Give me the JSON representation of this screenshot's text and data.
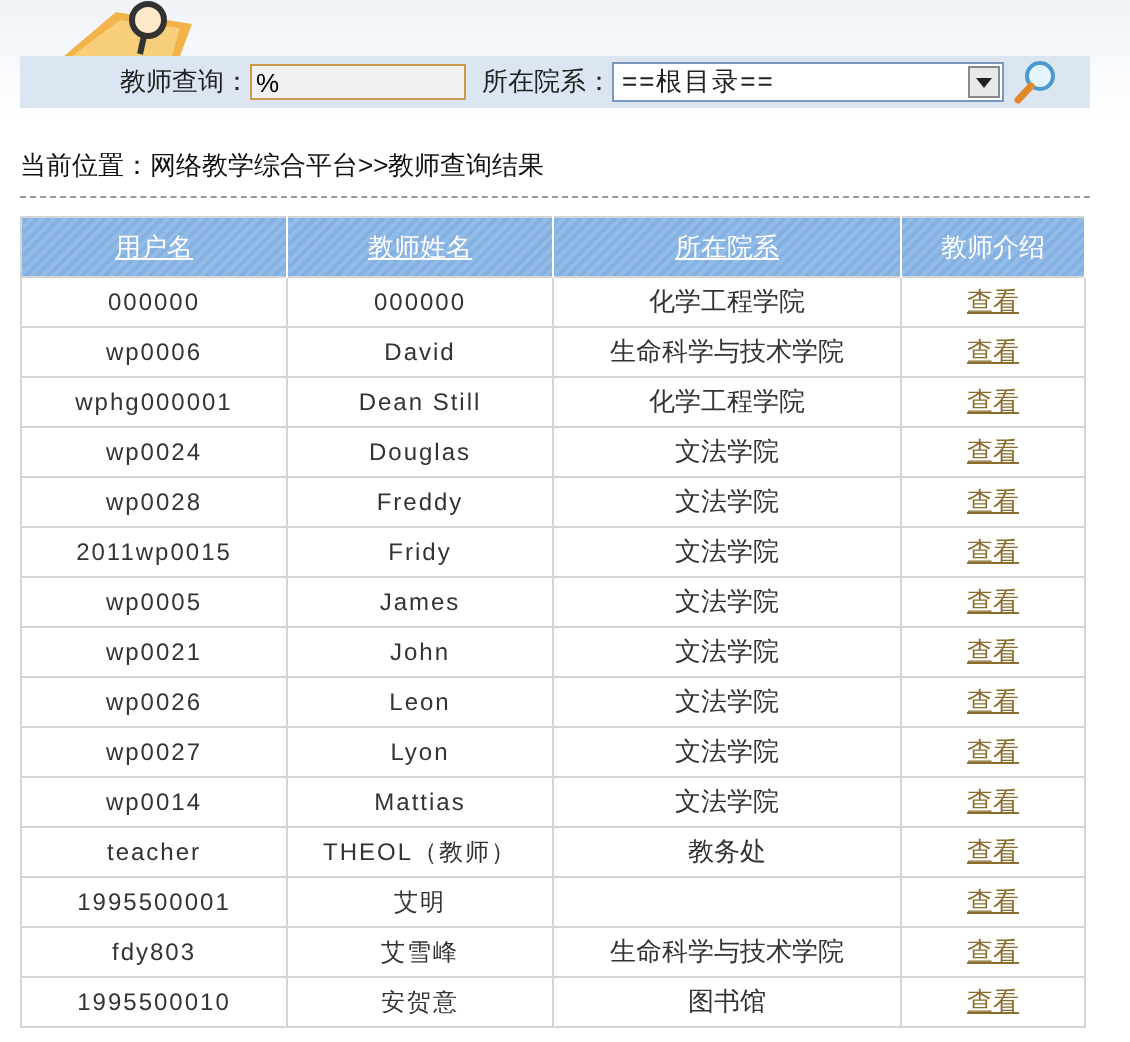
{
  "search": {
    "label": "教师查询：",
    "value": "%",
    "dept_label": "所在院系：",
    "dept_value": "==根目录=="
  },
  "breadcrumb": "当前位置：网络教学综合平台>>教师查询结果",
  "table": {
    "columns": [
      {
        "label": "用户名",
        "link": true
      },
      {
        "label": "教师姓名",
        "link": true
      },
      {
        "label": "所在院系",
        "link": true
      },
      {
        "label": "教师介绍",
        "link": false
      }
    ],
    "rows": [
      {
        "cells": [
          "000000",
          "000000",
          "化学工程学院"
        ],
        "action": "查看"
      },
      {
        "cells": [
          "wp0006",
          "David",
          "生命科学与技术学院"
        ],
        "action": "查看"
      },
      {
        "cells": [
          "wphg000001",
          "Dean Still",
          "化学工程学院"
        ],
        "action": "查看"
      },
      {
        "cells": [
          "wp0024",
          "Douglas",
          "文法学院"
        ],
        "action": "查看"
      },
      {
        "cells": [
          "wp0028",
          "Freddy",
          "文法学院"
        ],
        "action": "查看"
      },
      {
        "cells": [
          "2011wp0015",
          "Fridy",
          "文法学院"
        ],
        "action": "查看"
      },
      {
        "cells": [
          "wp0005",
          "James",
          "文法学院"
        ],
        "action": "查看"
      },
      {
        "cells": [
          "wp0021",
          "John",
          "文法学院"
        ],
        "action": "查看"
      },
      {
        "cells": [
          "wp0026",
          "Leon",
          "文法学院"
        ],
        "action": "查看"
      },
      {
        "cells": [
          "wp0027",
          "Lyon",
          "文法学院"
        ],
        "action": "查看"
      },
      {
        "cells": [
          "wp0014",
          "Mattias",
          "文法学院"
        ],
        "action": "查看"
      },
      {
        "cells": [
          "teacher",
          "THEOL（教师）",
          "教务处"
        ],
        "action": "查看"
      },
      {
        "cells": [
          "1995500001",
          "艾明",
          ""
        ],
        "action": "查看"
      },
      {
        "cells": [
          "fdy803",
          "艾雪峰",
          "生命科学与技术学院"
        ],
        "action": "查看"
      },
      {
        "cells": [
          "1995500010",
          "安贺意",
          "图书馆"
        ],
        "action": "查看"
      }
    ]
  }
}
